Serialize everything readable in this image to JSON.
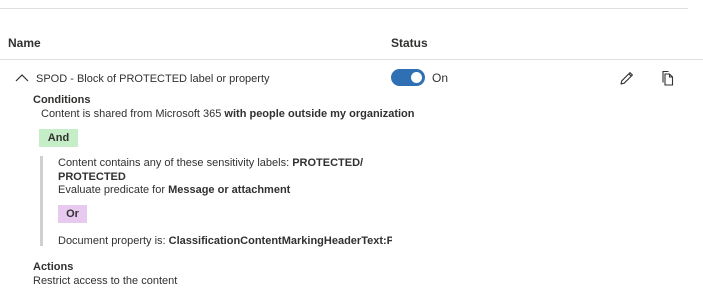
{
  "table": {
    "col_name": "Name",
    "col_status": "Status"
  },
  "rule": {
    "name": "SPOD - Block of PROTECTED label or property",
    "status_label": "On",
    "status_on": true
  },
  "conditions": {
    "title": "Conditions",
    "line1_prefix": "Content is shared from Microsoft 365 ",
    "line1_bold": "with people outside my organization",
    "and_label": "And",
    "group": {
      "labels_prefix": "Content contains any of these sensitivity labels: ",
      "labels_bold_line1": "PROTECTED/",
      "labels_bold_line2": "PROTECTED",
      "evaluate_prefix": "Evaluate predicate for ",
      "evaluate_bold": "Message or attachment",
      "or_label": "Or",
      "doc_prop_prefix": "Document property is: ",
      "doc_prop_bold": "ClassificationContentMarkingHeaderText:PROTE"
    }
  },
  "actions": {
    "title": "Actions",
    "line1": "Restrict access to the content"
  },
  "icons": {
    "expand": "chevron-up-icon",
    "edit": "pencil-icon",
    "copy": "copy-icon"
  },
  "colors": {
    "toggle_on": "#2f6fb3",
    "and_badge": "#c5edc7",
    "or_badge": "#e8c9ef"
  }
}
